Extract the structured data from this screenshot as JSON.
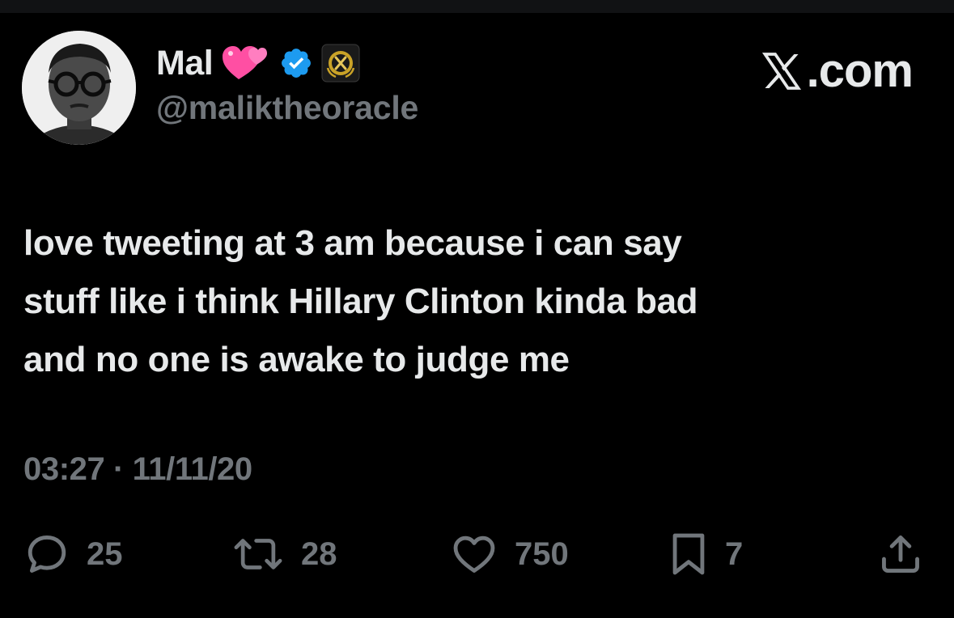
{
  "user": {
    "display_name": "Mal",
    "handle": "@maliktheoracle",
    "verified": true,
    "emoji": "two-hearts-emoji",
    "badge": "x-gold-affiliate-badge",
    "avatar": "avatar-photo"
  },
  "brand": {
    "label": ".com",
    "logo": "x-logo-icon"
  },
  "tweet": {
    "lines": [
      "love tweeting at 3 am because i can say",
      "stuff like i think Hillary Clinton kinda bad",
      "and no one is awake to judge me"
    ],
    "timestamp": "03:27 · 11/11/20"
  },
  "actions": {
    "replies": "25",
    "retweets": "28",
    "likes": "750",
    "bookmarks": "7"
  },
  "colors": {
    "background": "#000000",
    "text_primary": "#e7e9ea",
    "text_secondary": "#71767b",
    "verified_blue": "#1d9bf0",
    "heart_pink": "#ff4fa3",
    "badge_gold": "#c9a227"
  }
}
